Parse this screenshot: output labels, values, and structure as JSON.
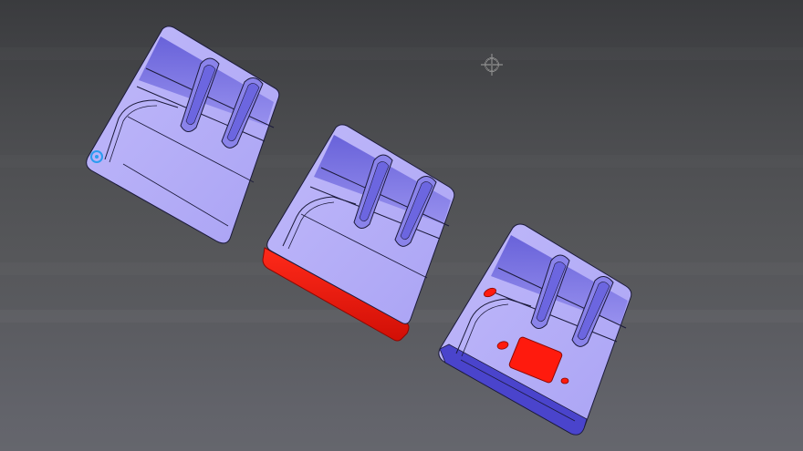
{
  "viewport": {
    "background_top": "#3a3b3e",
    "background_bottom": "#65666d"
  },
  "colors": {
    "body_light": "#b5aef7",
    "body_mid": "#9f98ee",
    "body_shadow": "#5b55d9",
    "body_dark": "#3f3ab8",
    "edge_line": "#1b1a3a",
    "highlight_red": "#ff1a0d",
    "highlight_red_dark": "#b80c05",
    "origin_marker": "#2b9cf0"
  },
  "scene": {
    "parts": [
      {
        "name": "mold-part-left",
        "red_face": "none"
      },
      {
        "name": "mold-part-middle",
        "red_face": "front-edge"
      },
      {
        "name": "mold-part-right",
        "red_face": "top-pocket"
      }
    ],
    "cursor_icon": "crosshair-cursor-icon",
    "origin_icon": "coordinate-origin-icon"
  }
}
